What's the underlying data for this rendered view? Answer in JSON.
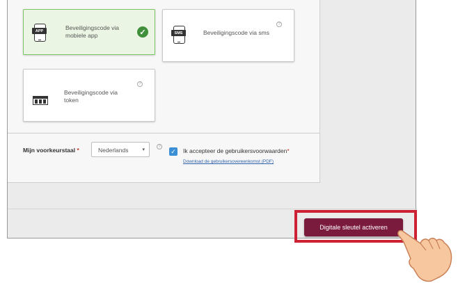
{
  "security_options": [
    {
      "label": "Beveiligingscode via mobiele app",
      "icon_text": "APP",
      "selected": true
    },
    {
      "label": "Beveiligingscode via sms",
      "icon_text": "SMS",
      "selected": false
    },
    {
      "label": "Beveiligingscode via token",
      "icon": "token-icon",
      "selected": false
    }
  ],
  "help_glyph": "?",
  "check_glyph": "✓",
  "language": {
    "label": "Mijn voorkeurstaal",
    "required_mark": "*",
    "selected_value": "Nederlands",
    "caret": "▾"
  },
  "terms": {
    "checked": true,
    "label": "Ik accepteer de gebruikersvoorwaarden",
    "required_mark": "*",
    "download_link": "Download de gebruikersovereenkomst (PDF)"
  },
  "activate_button": {
    "label": "Digitale sleutel activeren"
  },
  "colors": {
    "accent": "#7a1a3d",
    "highlight": "#cc2233",
    "selected_bg": "#eaf6e3",
    "check": "#3f8f3b",
    "checkbox": "#3b8fd4",
    "link": "#2c5fa8"
  }
}
